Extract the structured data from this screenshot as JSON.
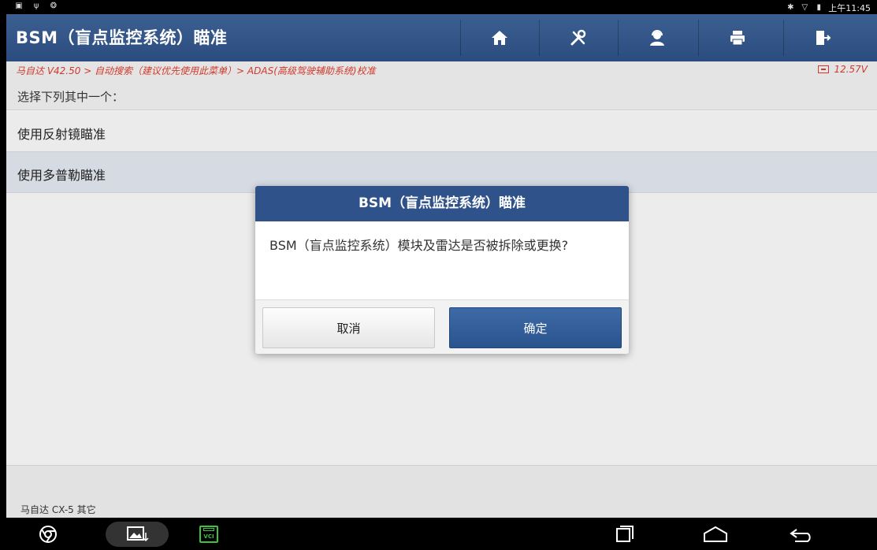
{
  "status_bar": {
    "time": "上午11:45",
    "left_icons": [
      "screenshot-icon",
      "usb-icon",
      "accessibility-icon"
    ],
    "right_icons": [
      "bluetooth-icon",
      "wifi-icon",
      "battery-icon"
    ]
  },
  "header": {
    "title": "BSM（盲点监控系统）瞄准",
    "buttons": [
      {
        "name": "home-icon"
      },
      {
        "name": "tools-icon"
      },
      {
        "name": "support-icon"
      },
      {
        "name": "print-icon"
      },
      {
        "name": "exit-icon"
      }
    ]
  },
  "breadcrumb": {
    "path": "马自达 V42.50 > 自动搜索（建议优先使用此菜单）> ADAS(高级驾驶辅助系统)校准",
    "voltage": "12.57V"
  },
  "prompt": "选择下列其中一个：",
  "menu": {
    "items": [
      {
        "label": "使用反射镜瞄准"
      },
      {
        "label": "使用多普勒瞄准"
      }
    ]
  },
  "footer": {
    "vehicle": "马自达 CX-5 其它"
  },
  "dialog": {
    "title": "BSM（盲点监控系统）瞄准",
    "message": "BSM（盲点监控系统）模块及雷达是否被拆除或更换?",
    "cancel_label": "取消",
    "ok_label": "确定"
  },
  "nav": {
    "vci_label": "VCI"
  },
  "colors": {
    "header_bg": "#2b4c7e",
    "breadcrumb_text": "#d0392b",
    "dialog_title_bg": "#2e5289",
    "ok_button_bg": "#2a548e"
  }
}
